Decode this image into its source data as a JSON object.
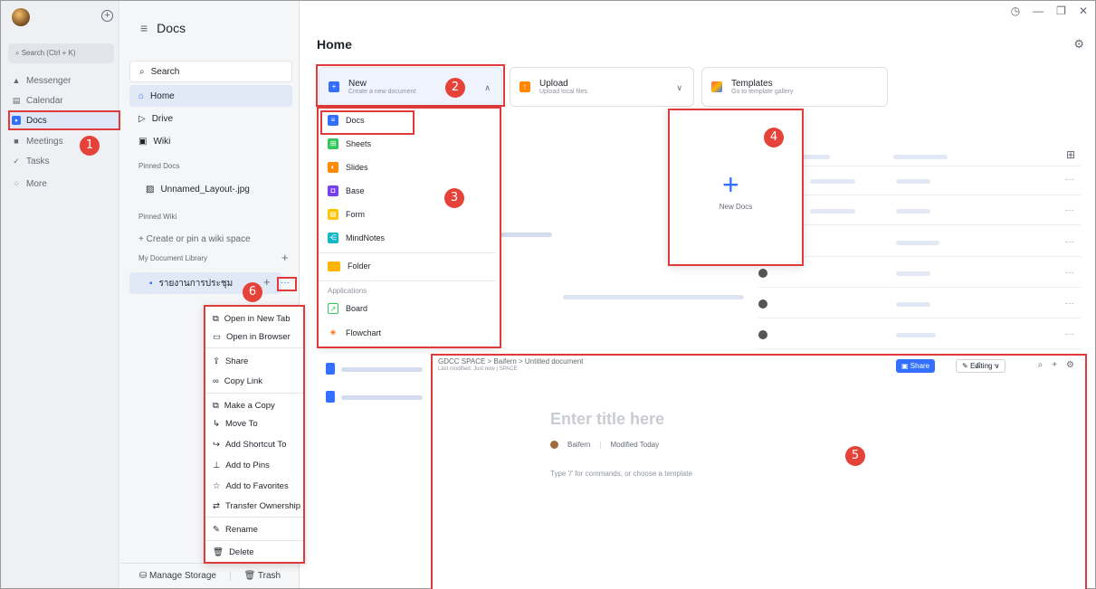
{
  "rail": {
    "search_label": "Search (Ctrl + K)",
    "items": [
      {
        "label": "Messenger",
        "icon": "messenger-icon"
      },
      {
        "label": "Calendar",
        "icon": "calendar-icon"
      },
      {
        "label": "Docs",
        "icon": "docs-icon"
      },
      {
        "label": "Meetings",
        "icon": "meetings-icon"
      },
      {
        "label": "Tasks",
        "icon": "tasks-icon"
      },
      {
        "label": "More",
        "icon": "more-icon"
      }
    ]
  },
  "docs_side": {
    "title": "Docs",
    "search": "Search",
    "home": "Home",
    "drive": "Drive",
    "wiki": "Wiki",
    "pinned_docs": "Pinned Docs",
    "pinned_file": "Unnamed_Layout-.jpg",
    "pinned_wiki": "Pinned Wiki",
    "create_wiki": "+ Create or pin a wiki space",
    "library": "My Document Library",
    "library_doc": "รายงานการประชุม",
    "manage_storage": "Manage Storage",
    "trash": "Trash"
  },
  "main": {
    "title": "Home",
    "new_card": {
      "title": "New",
      "subtitle": "Create a new document"
    },
    "upload_card": {
      "title": "Upload",
      "subtitle": "Upload local files"
    },
    "templates_card": {
      "title": "Templates",
      "subtitle": "Go to template gallery"
    },
    "new_docs_label": "New Docs"
  },
  "dropdown": {
    "items": [
      "Docs",
      "Sheets",
      "Slides",
      "Base",
      "Form",
      "MindNotes",
      "Folder"
    ],
    "section": "Applications",
    "apps": [
      "Board",
      "Flowchart"
    ]
  },
  "context_menu": {
    "items": [
      "Open in New Tab",
      "Open in Browser",
      "Share",
      "Copy Link",
      "Make a Copy",
      "Move To",
      "Add Shortcut To",
      "Add to Pins",
      "Add to Favorites",
      "Transfer Ownership",
      "Rename",
      "Delete"
    ]
  },
  "editor": {
    "breadcrumb": "GDCC SPACE > Baifern > Untitled document",
    "last_modified": "Last modified: Just now  |  SPACE",
    "share": "Share",
    "editing": "Editing",
    "title_placeholder": "Enter title here",
    "author": "Baifern",
    "modified": "Modified Today",
    "hint": "Type '/' for commands, or choose a template"
  },
  "badges": [
    "1",
    "2",
    "3",
    "4",
    "5",
    "6"
  ]
}
